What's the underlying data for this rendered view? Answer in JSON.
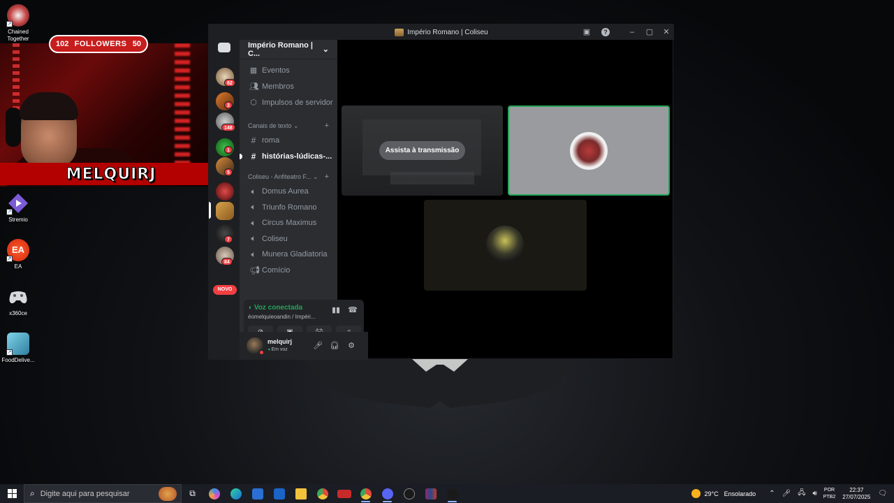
{
  "desktop": {
    "icons": [
      {
        "label_line1": "Chained",
        "label_line2": "Together"
      },
      {
        "label": "Stremio"
      },
      {
        "label": "EA"
      },
      {
        "label": "x360ce"
      },
      {
        "label": "FoodDelive..."
      }
    ]
  },
  "webcam": {
    "name": "MELQUIRJ",
    "followers_left": "102",
    "followers_label": "FOLLOWERS",
    "followers_right": "50"
  },
  "window": {
    "title": "Império Romano | Coliseu"
  },
  "guilds": {
    "badges": [
      "82",
      "3",
      "148",
      "1",
      "5",
      "7",
      "84"
    ],
    "novo": "NOVO"
  },
  "server": {
    "name": "Império Romano | C...",
    "menu": [
      {
        "icon": "calendar-icon",
        "label": "Eventos"
      },
      {
        "icon": "members-icon",
        "label": "Membros"
      },
      {
        "icon": "boost-icon",
        "label": "Impulsos de servidor"
      }
    ],
    "text_category": "Canais de texto",
    "text_channels": [
      {
        "label": "roma",
        "unread": false
      },
      {
        "label": "histórias-lúdicas-...",
        "unread": true
      }
    ],
    "voice_category": "Coliseu - Anfiteatro F...",
    "voice_channels": [
      {
        "label": "Domus Aurea"
      },
      {
        "label": "Triunfo Romano"
      },
      {
        "label": "Circus Maximus"
      },
      {
        "label": "Coliseu"
      },
      {
        "label": "Munera Gladiatoria"
      },
      {
        "label": "Comício"
      }
    ]
  },
  "voice": {
    "status": "Voz conectada",
    "location": "éomelquieoandin / Impéri..."
  },
  "user": {
    "name": "melquirj",
    "status": "Em voz"
  },
  "stage": {
    "watch_label": "Assista à transmissão"
  },
  "taskbar": {
    "search_placeholder": "Digite aqui para pesquisar",
    "weather_temp": "29°C",
    "weather_desc": "Ensolarado",
    "lang_1": "POR",
    "lang_2": "PTB2",
    "time": "22:37",
    "date": "27/07/2025"
  }
}
